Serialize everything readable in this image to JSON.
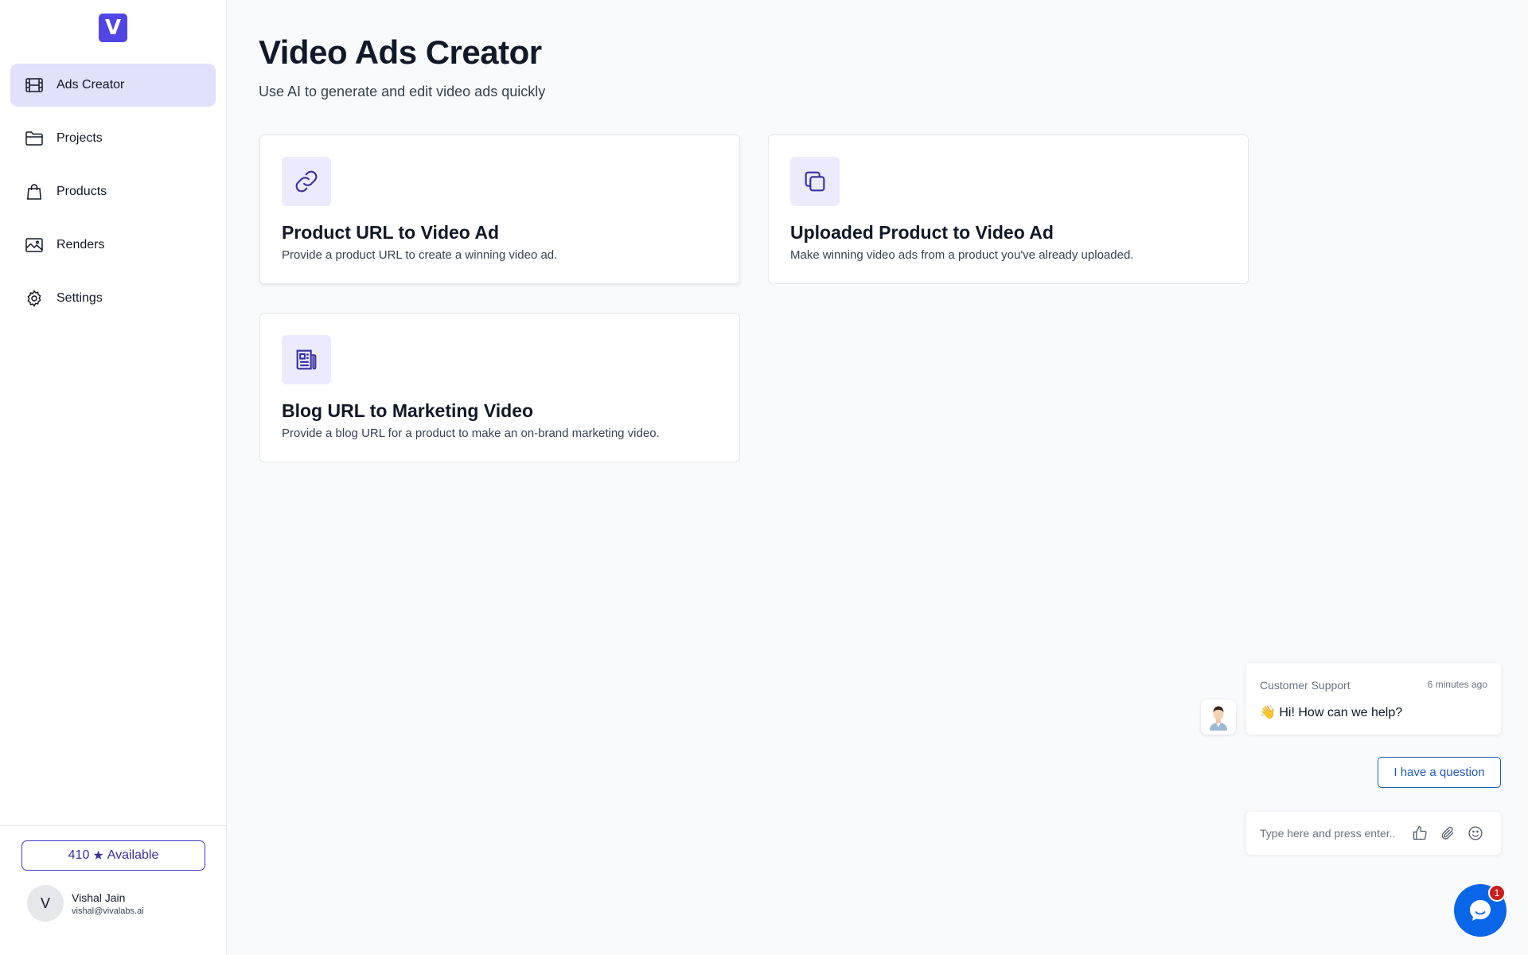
{
  "sidebar": {
    "logo_letter": "V",
    "items": [
      {
        "label": "Ads Creator",
        "icon": "film-icon",
        "active": true
      },
      {
        "label": "Projects",
        "icon": "folder-icon",
        "active": false
      },
      {
        "label": "Products",
        "icon": "shopping-bag-icon",
        "active": false
      },
      {
        "label": "Renders",
        "icon": "image-icon",
        "active": false
      },
      {
        "label": "Settings",
        "icon": "gear-icon",
        "active": false
      }
    ],
    "credits": {
      "count": "410",
      "label": "Available"
    },
    "user": {
      "initial": "V",
      "name": "Vishal Jain",
      "email": "vishal@vivalabs.ai"
    }
  },
  "main": {
    "title": "Video Ads Creator",
    "subtitle": "Use AI to generate and edit video ads quickly",
    "cards": [
      {
        "title": "Product URL to Video Ad",
        "description": "Provide a product URL to create a winning video ad.",
        "icon": "link-icon"
      },
      {
        "title": "Uploaded Product to Video Ad",
        "description": "Make winning video ads from a product you've already uploaded.",
        "icon": "copy-icon"
      },
      {
        "title": "Blog URL to Marketing Video",
        "description": "Provide a blog URL for a product to make an on-brand marketing video.",
        "icon": "newspaper-icon"
      }
    ]
  },
  "chat": {
    "sender": "Customer Support",
    "time": "6 minutes ago",
    "message": "👋 Hi! How can we help?",
    "quick_reply": "I have a question",
    "input_placeholder": "Type here and press enter..",
    "badge_count": "1"
  },
  "colors": {
    "accent": "#4f46e5",
    "active_nav_bg": "#e0e1fb",
    "card_icon_bg": "#ecebfd",
    "chat_blue": "#0a66e8",
    "badge_red": "#c81e1e"
  }
}
